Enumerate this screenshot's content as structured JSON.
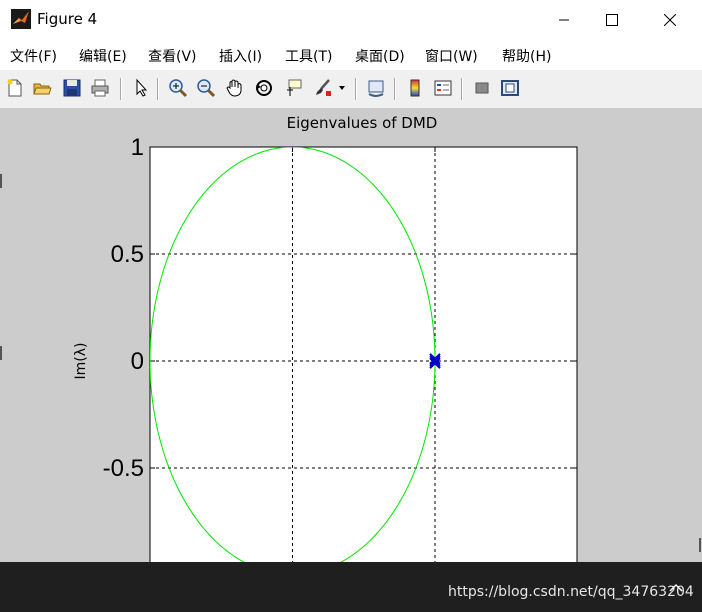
{
  "window": {
    "title": "Figure 4"
  },
  "menu": {
    "items": [
      "文件(F)",
      "编辑(E)",
      "查看(V)",
      "插入(I)",
      "工具(T)",
      "桌面(D)",
      "窗口(W)",
      "帮助(H)"
    ]
  },
  "toolbar": {
    "icons": [
      "new-figure-icon",
      "open-file-icon",
      "save-icon",
      "print-icon",
      "pointer-icon",
      "zoom-in-icon",
      "zoom-out-icon",
      "pan-hand-icon",
      "rotate-3d-icon",
      "data-cursor-icon",
      "brush-icon",
      "link-plot-icon",
      "colorbar-icon",
      "legend-icon",
      "hide-plot-tools-icon",
      "show-plot-tools-icon"
    ]
  },
  "axes": {
    "title": "Eigenvalues of DMD",
    "ylabel": "Im(λ)",
    "yticks": [
      "1",
      "0.5",
      "0",
      "-0.5"
    ]
  },
  "colors": {
    "unit_circle": "#00e600",
    "eigen_marker": "#0000cc",
    "grid": "#000000"
  },
  "chart_data": {
    "type": "scatter",
    "title": "Eigenvalues of DMD",
    "xlabel": "",
    "ylabel": "Im(λ)",
    "ylim": [
      -0.95,
      1
    ],
    "xlim": [
      -1,
      2
    ],
    "y_ticks": [
      1,
      0.5,
      0,
      -0.5
    ],
    "grid": true,
    "series": [
      {
        "kind": "unit-circle",
        "color": "#00e600",
        "center": [
          0,
          0
        ],
        "radius": 1
      },
      {
        "kind": "eigenvalues",
        "color": "#0000cc",
        "marker": "x",
        "x": [
          1,
          1,
          1
        ],
        "y": [
          0.01,
          0,
          -0.01
        ]
      }
    ]
  },
  "watermark": {
    "text": "https://blog.csdn.net/qq_34763204"
  }
}
